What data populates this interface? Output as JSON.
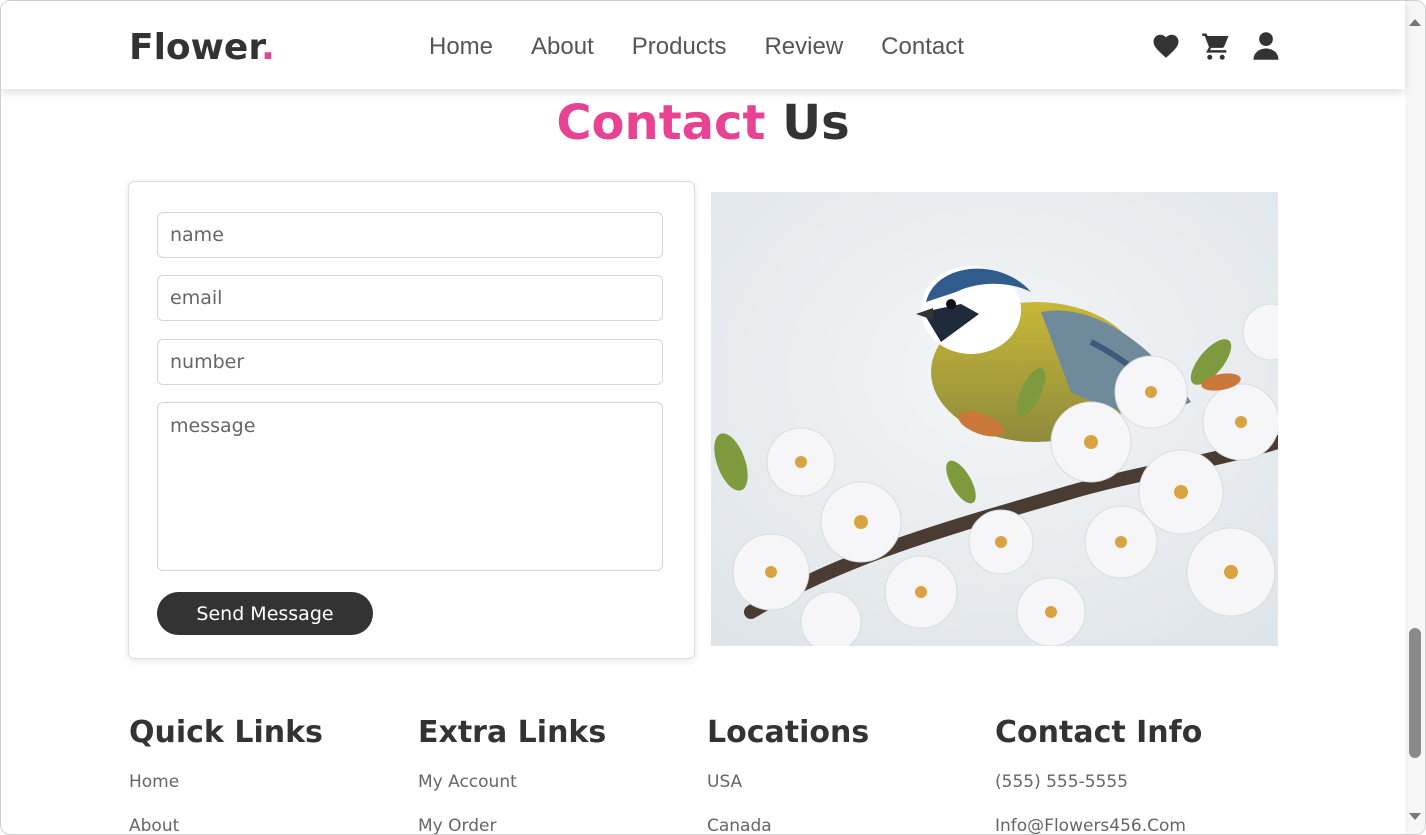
{
  "header": {
    "logo_text": "Flower",
    "logo_dot": ".",
    "nav": [
      "Home",
      "About",
      "Products",
      "Review",
      "Contact"
    ],
    "icons": [
      "heart-icon",
      "cart-icon",
      "user-icon"
    ]
  },
  "contact": {
    "title_accent": "Contact",
    "title_rest": "Us",
    "form": {
      "name_placeholder": "name",
      "email_placeholder": "email",
      "number_placeholder": "number",
      "message_placeholder": "message",
      "submit_label": "Send Message"
    }
  },
  "footer": {
    "columns": [
      {
        "title": "Quick Links",
        "links": [
          "Home",
          "About"
        ]
      },
      {
        "title": "Extra Links",
        "links": [
          "My Account",
          "My Order"
        ]
      },
      {
        "title": "Locations",
        "links": [
          "USA",
          "Canada"
        ]
      },
      {
        "title": "Contact Info",
        "links": [
          "(555) 555-5555",
          "Info@Flowers456.Com"
        ]
      }
    ]
  },
  "colors": {
    "accent": "#e84393",
    "dark": "#333333"
  }
}
